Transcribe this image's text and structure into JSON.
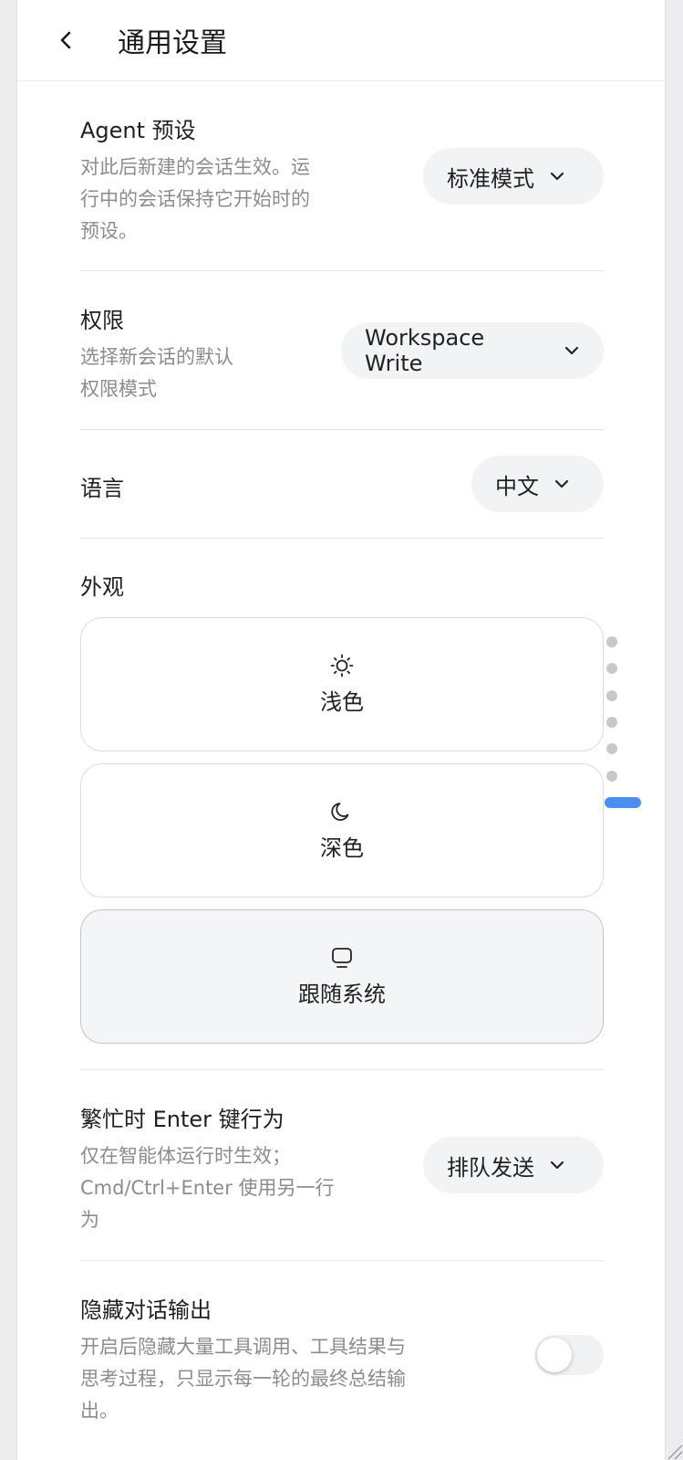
{
  "header": {
    "title": "通用设置"
  },
  "agent_preset": {
    "title": "Agent 预设",
    "desc_lines": [
      "对此后新建的会话生效。运",
      "行中的会话保持它开始时的",
      "预设。"
    ],
    "value": "标准模式"
  },
  "permissions": {
    "title": "权限",
    "desc_lines": [
      "选择新会话的默认",
      "权限模式"
    ],
    "value": "Workspace Write"
  },
  "language": {
    "title": "语言",
    "value": "中文"
  },
  "appearance": {
    "title": "外观",
    "options": [
      {
        "label": "浅色",
        "icon": "sun-icon",
        "selected": false
      },
      {
        "label": "深色",
        "icon": "moon-icon",
        "selected": false
      },
      {
        "label": "跟随系统",
        "icon": "monitor-icon",
        "selected": true
      }
    ]
  },
  "busy_enter": {
    "title": "繁忙时 Enter 键行为",
    "desc_lines": [
      "仅在智能体运行时生效；",
      "Cmd/Ctrl+Enter 使用另一行",
      "为"
    ],
    "value": "排队发送"
  },
  "hide_output": {
    "title": "隐藏对话输出",
    "desc_lines": [
      "开启后隐藏大量工具调用、工具结果与",
      "思考过程，只显示每一轮的最终总结输",
      "出。"
    ],
    "enabled": false
  },
  "colors": {
    "accent": "#4a8ef0",
    "pill_bg": "#f2f3f5",
    "selected_card_bg": "#f4f5f7"
  }
}
